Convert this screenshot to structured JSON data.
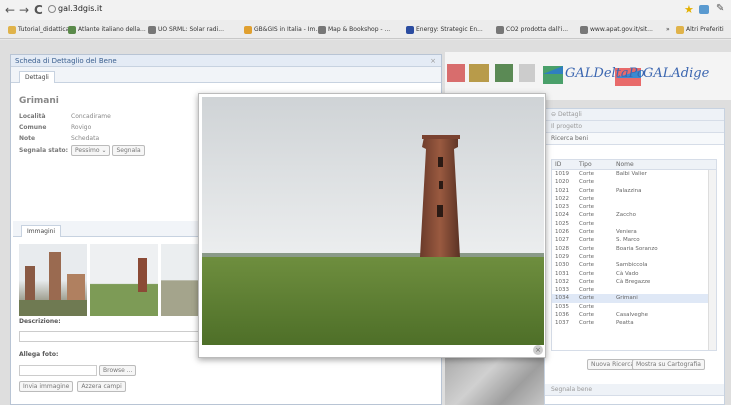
{
  "browser": {
    "url": "gal.3dgis.it",
    "back_icon": "←",
    "forward_icon": "→",
    "reload_icon": "C"
  },
  "bookmarks": [
    {
      "label": "Tutorial_didattica",
      "color": "#e0b34a"
    },
    {
      "label": "Atlante italiano della...",
      "color": "#5a8a4a"
    },
    {
      "label": "UO SRML: Solar radi...",
      "color": "#777"
    },
    {
      "label": "GB&GIS in Italia - Im...",
      "color": "#e0a030"
    },
    {
      "label": "Map & Bookshop - ...",
      "color": "#777"
    },
    {
      "label": "Energy: Strategic En...",
      "color": "#2b4ca0"
    },
    {
      "label": "CO2 prodotta dall'i...",
      "color": "#777"
    },
    {
      "label": "www.apat.gov.it/sit...",
      "color": "#777"
    }
  ],
  "bookmarks_more": "»",
  "other_bookmarks": "Altri Preferiti",
  "window": {
    "title": "Scheda di Dettaglio del Bene",
    "close": "×",
    "tab": "Dettagli"
  },
  "detail": {
    "name": "Grimani",
    "rows": [
      {
        "key": "Località",
        "value": "Concadirame"
      },
      {
        "key": "Comune",
        "value": "Rovigo"
      },
      {
        "key": "Note",
        "value": "Schedata"
      }
    ],
    "status_label": "Segnala stato:",
    "status_value": "Pessimo",
    "report_button": "Segnala"
  },
  "images_tab": "Immagini",
  "description_label": "Descrizione:",
  "attach_label": "Allega foto:",
  "browse_button": "Browse ...",
  "send_button": "Invia immagine",
  "reset_button": "Azzera campi",
  "logos": {
    "gal1": "GALDeltaPo",
    "gal2": "GALAdige"
  },
  "panel": {
    "header1": "Dettagli",
    "header2": "Il progetto",
    "header3": "Ricerca beni",
    "columns": [
      "ID",
      "Tipo",
      "Nome"
    ],
    "rows": [
      [
        "1019",
        "Corte",
        "Balbi Valier"
      ],
      [
        "1020",
        "Corte",
        ""
      ],
      [
        "1021",
        "Corte",
        "Palazzina"
      ],
      [
        "1022",
        "Corte",
        ""
      ],
      [
        "1023",
        "Corte",
        ""
      ],
      [
        "1024",
        "Corte",
        "Zaccho"
      ],
      [
        "1025",
        "Corte",
        ""
      ],
      [
        "1026",
        "Corte",
        "Veniera"
      ],
      [
        "1027",
        "Corte",
        "S. Marco"
      ],
      [
        "1028",
        "Corte",
        "Boaria Soranzo"
      ],
      [
        "1029",
        "Corte",
        ""
      ],
      [
        "1030",
        "Corte",
        "Sambiccola"
      ],
      [
        "1031",
        "Corte",
        "Cà Vado"
      ],
      [
        "1032",
        "Corte",
        "Cà Bregazze"
      ],
      [
        "1033",
        "Corte",
        ""
      ],
      [
        "1034",
        "Corte",
        "Grimani"
      ],
      [
        "1035",
        "Corte",
        ""
      ],
      [
        "1036",
        "Corte",
        "Casalveghe"
      ],
      [
        "1037",
        "Corte",
        "Peatta"
      ]
    ],
    "new_search": "Nuova Ricerca",
    "show_map": "Mostra su Cartografia",
    "report": "Segnala bene"
  }
}
